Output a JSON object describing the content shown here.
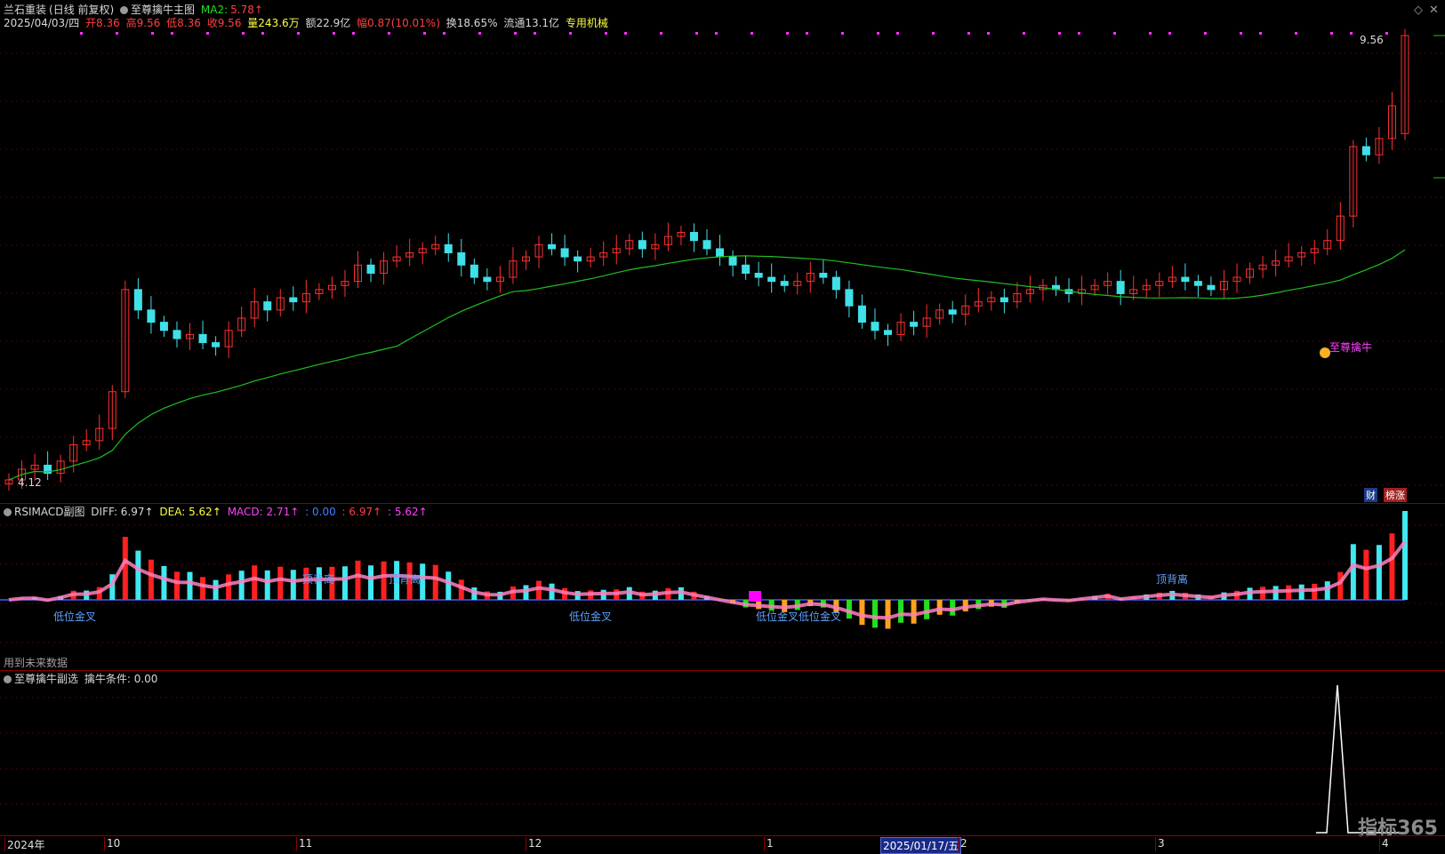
{
  "main": {
    "stock_name": "兰石重装",
    "period": "(日线 前复权)",
    "indicator_name": "至尊擒牛主图",
    "ma_label": "MA2:",
    "ma_value": "5.78↑",
    "date": "2025/04/03/四",
    "open": "开8.36",
    "high": "高9.56",
    "low": "低8.36",
    "close": "收9.56",
    "volume": "量243.6万",
    "amount": "额22.9亿",
    "change": "幅0.87(10.01%)",
    "turnover": "换18.65%",
    "float_cap": "流通13.1亿",
    "industry": "专用机械",
    "max_price": "9.56",
    "min_price": "4.12",
    "signal_label": "至尊擒牛",
    "badge_fin": "财",
    "badge_rank": "榜涨"
  },
  "sub": {
    "name": "RSIMACD副图",
    "diff": "DIFF: 6.97↑",
    "dea": "DEA: 5.62↑",
    "macd": "MACD: 2.71↑",
    "v1": ": 0.00",
    "v2": ": 6.97↑",
    "v3": ": 5.62↑",
    "footnote": "用到未来数据",
    "labels": {
      "golden_cross": "低位金叉",
      "top_divergence": "顶背离"
    }
  },
  "selector": {
    "name": "至尊擒牛副选",
    "cond_label": "擒牛条件: 0.00"
  },
  "axis": {
    "ticks": [
      "2024年",
      "10",
      "11",
      "12",
      "1",
      "2",
      "3",
      "4"
    ],
    "current_date": "2025/01/17/五"
  },
  "brand": "指标365",
  "colors": {
    "up": "#ff3030",
    "down": "#40e0e8",
    "ma": "#20c020",
    "grid": "#5a0000",
    "pink": "#ff80c0"
  },
  "chart_data": {
    "type": "candlestick",
    "price_range": [
      4.12,
      9.56
    ],
    "closes": [
      4.12,
      4.25,
      4.3,
      4.2,
      4.35,
      4.55,
      4.6,
      4.75,
      5.2,
      6.45,
      6.2,
      6.05,
      5.95,
      5.85,
      5.9,
      5.8,
      5.75,
      5.95,
      6.1,
      6.3,
      6.2,
      6.35,
      6.3,
      6.4,
      6.45,
      6.5,
      6.55,
      6.75,
      6.65,
      6.8,
      6.85,
      6.9,
      6.95,
      7.0,
      6.9,
      6.75,
      6.6,
      6.55,
      6.6,
      6.8,
      6.85,
      7.0,
      6.95,
      6.85,
      6.8,
      6.85,
      6.9,
      6.95,
      7.05,
      6.95,
      7.0,
      7.1,
      7.15,
      7.05,
      6.95,
      6.85,
      6.75,
      6.65,
      6.6,
      6.55,
      6.5,
      6.55,
      6.65,
      6.6,
      6.45,
      6.25,
      6.05,
      5.95,
      5.9,
      6.05,
      6.0,
      6.1,
      6.2,
      6.15,
      6.25,
      6.3,
      6.35,
      6.3,
      6.4,
      6.45,
      6.5,
      6.45,
      6.4,
      6.45,
      6.5,
      6.55,
      6.4,
      6.45,
      6.5,
      6.55,
      6.6,
      6.55,
      6.5,
      6.45,
      6.55,
      6.6,
      6.7,
      6.75,
      6.8,
      6.85,
      6.9,
      6.95,
      7.05,
      7.35,
      8.2,
      8.1,
      8.3,
      8.7,
      9.56
    ]
  }
}
